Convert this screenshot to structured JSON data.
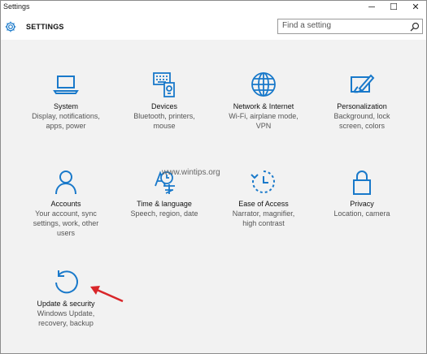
{
  "window": {
    "title": "Settings",
    "minimize_glyph": "─",
    "maximize_glyph": "☐",
    "close_glyph": "✕"
  },
  "header": {
    "label": "SETTINGS",
    "search_placeholder": "Find a setting"
  },
  "tiles": [
    {
      "icon": "laptop-icon",
      "name": "System",
      "desc": [
        "Display, notifications,",
        "apps, power"
      ]
    },
    {
      "icon": "devices-icon",
      "name": "Devices",
      "desc": [
        "Bluetooth, printers,",
        "mouse"
      ]
    },
    {
      "icon": "globe-icon",
      "name": "Network & Internet",
      "desc": [
        "Wi-Fi, airplane mode,",
        "VPN"
      ]
    },
    {
      "icon": "paintbrush-icon",
      "name": "Personalization",
      "desc": [
        "Background, lock",
        "screen, colors"
      ]
    },
    {
      "icon": "person-icon",
      "name": "Accounts",
      "desc": [
        "Your account, sync",
        "settings, work, other",
        "users"
      ]
    },
    {
      "icon": "time-language-icon",
      "name": "Time & language",
      "desc": [
        "Speech, region, date"
      ]
    },
    {
      "icon": "ease-of-access-icon",
      "name": "Ease of Access",
      "desc": [
        "Narrator, magnifier,",
        "high contrast"
      ]
    },
    {
      "icon": "lock-icon",
      "name": "Privacy",
      "desc": [
        "Location, camera"
      ]
    },
    {
      "icon": "refresh-icon",
      "name": "Update & security",
      "desc": [
        "Windows Update,",
        "recovery, backup"
      ]
    }
  ],
  "watermark": "www.wintips.org",
  "colors": {
    "accent": "#1979ca",
    "arrow": "#d9262a"
  }
}
